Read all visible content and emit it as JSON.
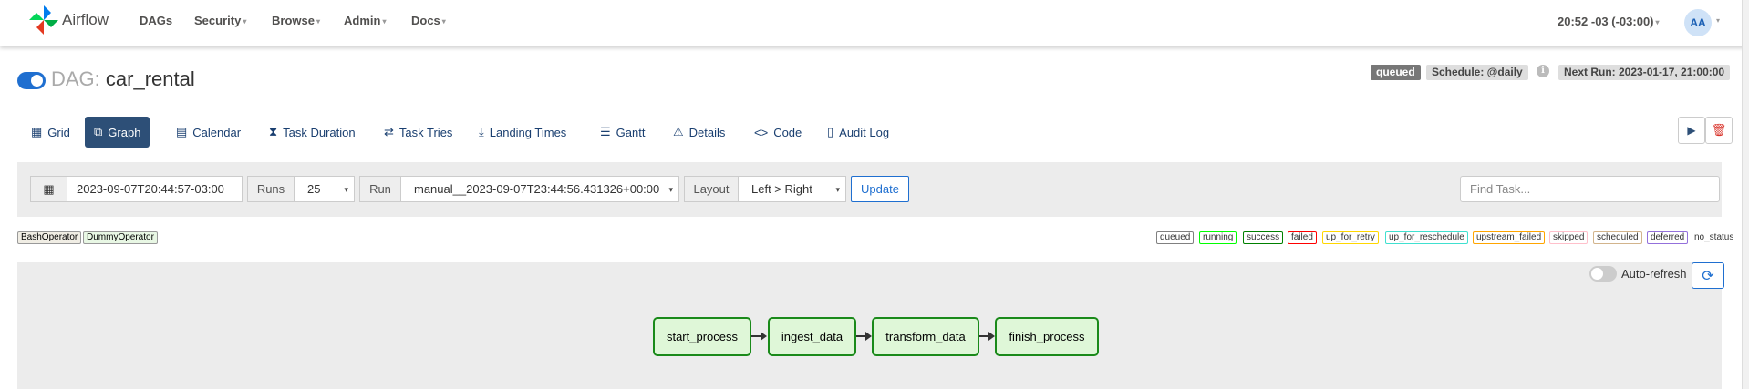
{
  "navbar": {
    "brand": "Airflow",
    "items": [
      {
        "label": "DAGs",
        "caret": false
      },
      {
        "label": "Security",
        "caret": true
      },
      {
        "label": "Browse",
        "caret": true
      },
      {
        "label": "Admin",
        "caret": true
      },
      {
        "label": "Docs",
        "caret": true
      }
    ],
    "time": "20:52 -03 (-03:00)",
    "avatar": "AA"
  },
  "dag": {
    "prefix": "DAG:",
    "name": "car_rental",
    "paused": false,
    "state_badge": "queued",
    "schedule": "Schedule: @daily",
    "next_run": "Next Run: 2023-01-17, 21:00:00"
  },
  "tabs": [
    {
      "label": "Grid",
      "icon": "grid-icon",
      "active": false
    },
    {
      "label": "Graph",
      "icon": "graph-icon",
      "active": true
    },
    {
      "label": "Calendar",
      "icon": "calendar-icon",
      "active": false
    },
    {
      "label": "Task Duration",
      "icon": "hourglass-icon",
      "active": false
    },
    {
      "label": "Task Tries",
      "icon": "retry-icon",
      "active": false
    },
    {
      "label": "Landing Times",
      "icon": "landing-icon",
      "active": false
    },
    {
      "label": "Gantt",
      "icon": "gantt-icon",
      "active": false
    },
    {
      "label": "Details",
      "icon": "warning-triangle-icon",
      "active": false
    },
    {
      "label": "Code",
      "icon": "code-icon",
      "active": false
    },
    {
      "label": "Audit Log",
      "icon": "file-icon",
      "active": false
    }
  ],
  "filters": {
    "base_date": "2023-09-07T20:44:57-03:00",
    "runs_label": "Runs",
    "runs_value": "25",
    "run_label": "Run",
    "run_value": "manual__2023-09-07T23:44:56.431326+00:00",
    "layout_label": "Layout",
    "layout_value": "Left > Right",
    "update_label": "Update",
    "find_placeholder": "Find Task..."
  },
  "operators": [
    {
      "label": "BashOperator",
      "color": "#f0ede4"
    },
    {
      "label": "DummyOperator",
      "color": "#e8f7e4"
    }
  ],
  "states": [
    {
      "label": "queued",
      "color": "#808080"
    },
    {
      "label": "running",
      "color": "#00ff00"
    },
    {
      "label": "success",
      "color": "#008000"
    },
    {
      "label": "failed",
      "color": "#ff0000"
    },
    {
      "label": "up_for_retry",
      "color": "#ffd700"
    },
    {
      "label": "up_for_reschedule",
      "color": "#40e0d0"
    },
    {
      "label": "upstream_failed",
      "color": "#ffa500"
    },
    {
      "label": "skipped",
      "color": "#ffc0cb"
    },
    {
      "label": "scheduled",
      "color": "#d2b48c"
    },
    {
      "label": "deferred",
      "color": "#9370db"
    }
  ],
  "no_status_label": "no_status",
  "graph": {
    "autorefresh_label": "Auto-refresh",
    "nodes": [
      {
        "label": "start_process"
      },
      {
        "label": "ingest_data"
      },
      {
        "label": "transform_data"
      },
      {
        "label": "finish_process"
      }
    ]
  },
  "colors": {
    "primary": "#1f6fd0",
    "active_tab": "#2d4f77",
    "success_border": "#1a8a1a"
  }
}
